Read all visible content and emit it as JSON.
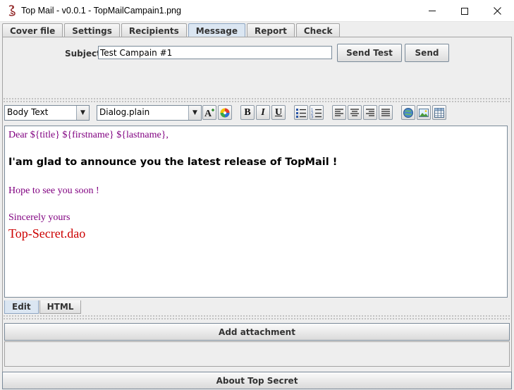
{
  "window": {
    "title": "Top Mail - v0.0.1 - TopMailCampain1.png",
    "icon": "dragon-app-icon",
    "controls": [
      "minimize-icon",
      "maximize-icon",
      "close-icon"
    ]
  },
  "tabs": [
    {
      "label": "Cover file",
      "active": false
    },
    {
      "label": "Settings",
      "active": false
    },
    {
      "label": "Recipients",
      "active": false
    },
    {
      "label": "Message",
      "active": true
    },
    {
      "label": "Report",
      "active": false
    },
    {
      "label": "Check",
      "active": false
    }
  ],
  "message": {
    "subject_label": "Subject",
    "subject_value": "Test Campain #1",
    "send_test_label": "Send Test",
    "send_label": "Send"
  },
  "toolbar": {
    "style_value": "Body Text",
    "font_value": "Dialog.plain",
    "buttons": [
      {
        "icon": "font-color-icon"
      },
      {
        "icon": "color-wheel-icon"
      },
      {
        "icon": "bold-icon",
        "glyph": "B"
      },
      {
        "icon": "italic-icon",
        "glyph": "I"
      },
      {
        "icon": "underline-icon",
        "glyph": "U"
      },
      {
        "icon": "bullet-list-icon"
      },
      {
        "icon": "numbered-list-icon"
      },
      {
        "icon": "align-left-icon"
      },
      {
        "icon": "align-center-icon"
      },
      {
        "icon": "align-right-icon"
      },
      {
        "icon": "align-justify-icon"
      },
      {
        "icon": "insert-link-icon"
      },
      {
        "icon": "insert-image-icon"
      },
      {
        "icon": "insert-table-icon"
      }
    ]
  },
  "editor": {
    "greeting": "Dear ${title} ${firstname} ${lastname},",
    "headline": "I'am glad to announce you the latest release of TopMail !",
    "line_hope": "Hope to see you soon !",
    "line_sincerely": "Sincerely yours",
    "signature": "Top-Secret.dao",
    "colors": {
      "body": "#800080",
      "signature": "#cc0000",
      "headline": "#000000"
    }
  },
  "editor_tabs": [
    {
      "label": "Edit",
      "active": true
    },
    {
      "label": "HTML",
      "active": false
    }
  ],
  "attachments": {
    "add_label": "Add attachment"
  },
  "footer": {
    "about_label": "About Top Secret"
  }
}
